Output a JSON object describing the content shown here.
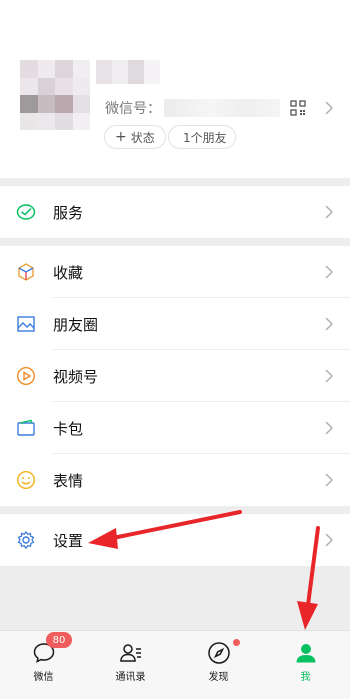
{
  "profile": {
    "wxid_label": "微信号：",
    "status_label": "状态",
    "status_plus": "+",
    "friends_label": "1个朋友",
    "qr_icon": "qr-code-icon",
    "chevron_icon": "chevron-right-icon"
  },
  "menu": {
    "service": {
      "label": "服务",
      "icon": "wechat-pay-icon",
      "color": "#07c160"
    },
    "favorites": {
      "label": "收藏",
      "icon": "cube-icon",
      "color": "#e6a23c"
    },
    "moments": {
      "label": "朋友圈",
      "icon": "picture-icon",
      "color": "#3b7ddd"
    },
    "channels": {
      "label": "视频号",
      "icon": "play-circle-icon",
      "color": "#f08a24"
    },
    "cards": {
      "label": "卡包",
      "icon": "card-wallet-icon",
      "color": "#3b7ddd"
    },
    "stickers": {
      "label": "表情",
      "icon": "smiley-icon",
      "color": "#f2b11c"
    },
    "settings": {
      "label": "设置",
      "icon": "gear-icon",
      "color": "#3b7ddd"
    }
  },
  "tabbar": {
    "chats": {
      "label": "微信",
      "badge": "80",
      "icon": "chat-bubble-icon"
    },
    "contacts": {
      "label": "通讯录",
      "icon": "contacts-icon"
    },
    "discover": {
      "label": "发现",
      "icon": "compass-icon"
    },
    "me": {
      "label": "我",
      "icon": "person-icon",
      "active_color": "#07c160"
    }
  },
  "annotation_color": "#e8262a"
}
